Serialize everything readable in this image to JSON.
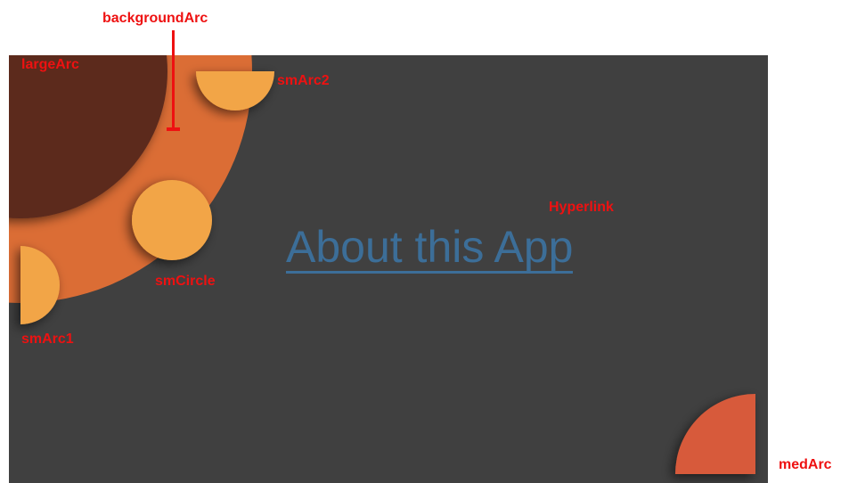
{
  "labels": {
    "background_arc": "backgroundArc",
    "large_arc": "largeArc",
    "small_arc_2": "smArc2",
    "small_circle": "smCircle",
    "small_arc_1": "smArc1",
    "hyperlink": "Hyperlink",
    "medium_arc": "medArc"
  },
  "hyperlink": {
    "text": "About this App"
  },
  "colors": {
    "panel_background": "#404040",
    "background_arc": "#db6d35",
    "large_arc": "#5b2a1f",
    "small_shapes": "#f2a547",
    "medium_arc": "#d75a3b",
    "hyperlink": "#3c6e98",
    "annotation": "#ee1111"
  }
}
